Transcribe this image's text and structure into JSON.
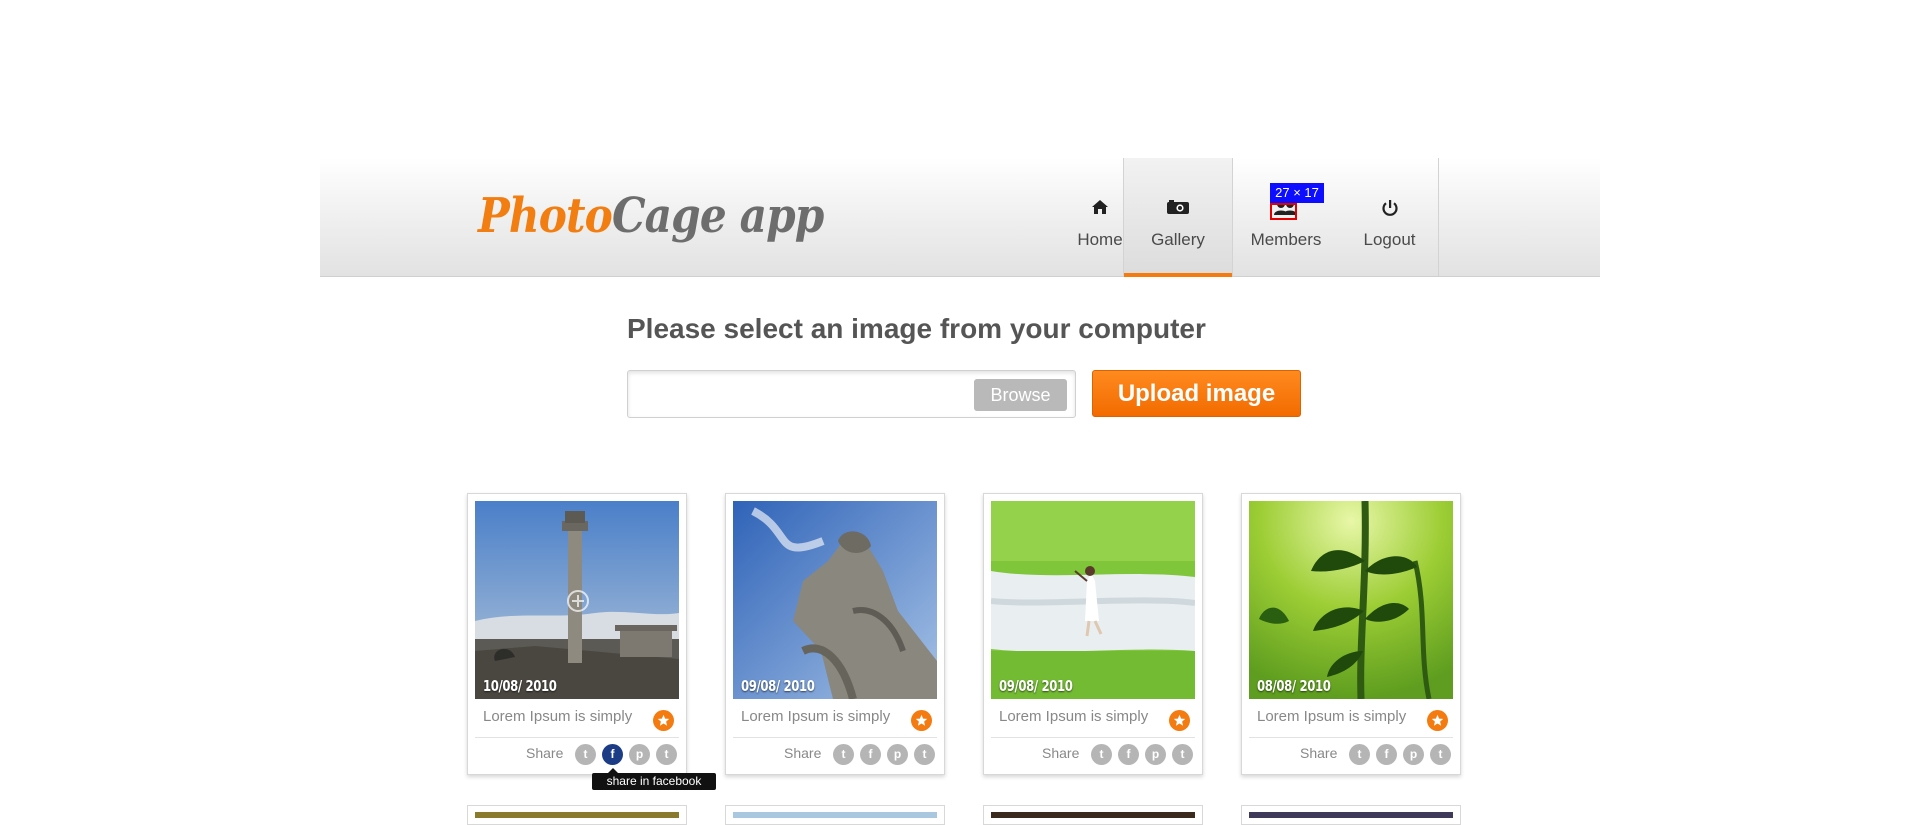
{
  "app": {
    "logo_part1": "Photo",
    "logo_part2": "Cage app"
  },
  "nav": [
    {
      "label": "Home",
      "icon": "home-icon",
      "active": false
    },
    {
      "label": "Gallery",
      "icon": "camera-icon",
      "active": true
    },
    {
      "label": "Members",
      "icon": "members-icon",
      "active": false
    },
    {
      "label": "Logout",
      "icon": "power-icon",
      "active": false
    }
  ],
  "dimension_tag": "27 × 17",
  "upload": {
    "title": "Please select an image from your computer",
    "file_value": "",
    "browse_label": "Browse",
    "upload_label": "Upload image"
  },
  "cards": [
    {
      "date": "10/08/ 2010",
      "title": "Lorem Ipsum is simply",
      "share_label": "Share"
    },
    {
      "date": "09/08/ 2010",
      "title": "Lorem Ipsum is simply",
      "share_label": "Share"
    },
    {
      "date": "09/08/ 2010",
      "title": "Lorem Ipsum is simply",
      "share_label": "Share"
    },
    {
      "date": "08/08/ 2010",
      "title": "Lorem Ipsum is simply",
      "share_label": "Share"
    }
  ],
  "share_icons": [
    "twitter-icon",
    "facebook-icon",
    "pinterest-icon",
    "tumblr-icon"
  ],
  "tooltip": "share in facebook",
  "colors": {
    "accent": "#f37b10",
    "facebook": "#1c3d86",
    "logo_gray": "#6d6d6d"
  }
}
